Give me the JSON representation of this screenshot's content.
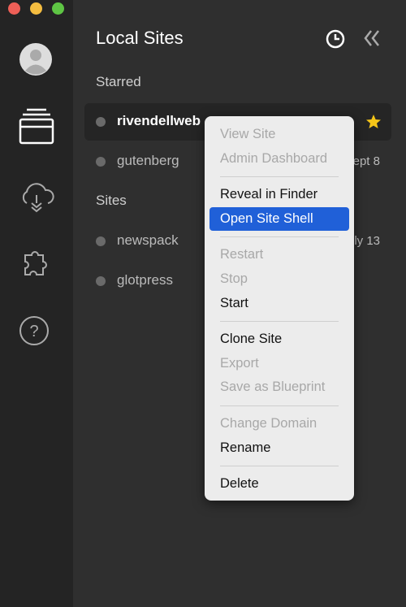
{
  "window": {
    "controls": [
      {
        "name": "close",
        "color": "#ee5f57"
      },
      {
        "name": "minimize",
        "color": "#f5bd40"
      },
      {
        "name": "zoom",
        "color": "#5ec544"
      }
    ]
  },
  "header": {
    "title": "Local Sites"
  },
  "sections": {
    "starred": "Starred",
    "sites": "Sites"
  },
  "starred_sites": [
    {
      "name": "rivendellweb",
      "starred": true,
      "date": ""
    },
    {
      "name": "gutenberg",
      "date": "ept 8"
    }
  ],
  "sites": [
    {
      "name": "newspack",
      "date": "ly 13"
    },
    {
      "name": "glotpress",
      "date": ""
    }
  ],
  "menu": {
    "items": [
      {
        "label": "View Site",
        "enabled": false
      },
      {
        "label": "Admin Dashboard",
        "enabled": false
      },
      {
        "label": "Reveal in Finder",
        "enabled": true
      },
      {
        "label": "Open Site Shell",
        "enabled": true,
        "highlighted": true
      },
      {
        "label": "Restart",
        "enabled": false
      },
      {
        "label": "Stop",
        "enabled": false
      },
      {
        "label": "Start",
        "enabled": true
      },
      {
        "label": "Clone Site",
        "enabled": true
      },
      {
        "label": "Export",
        "enabled": false
      },
      {
        "label": "Save as Blueprint",
        "enabled": false
      },
      {
        "label": "Change Domain",
        "enabled": false
      },
      {
        "label": "Rename",
        "enabled": true
      },
      {
        "label": "Delete",
        "enabled": true
      }
    ]
  },
  "colors": {
    "highlight": "#2060d8",
    "star": "#f5c518"
  }
}
